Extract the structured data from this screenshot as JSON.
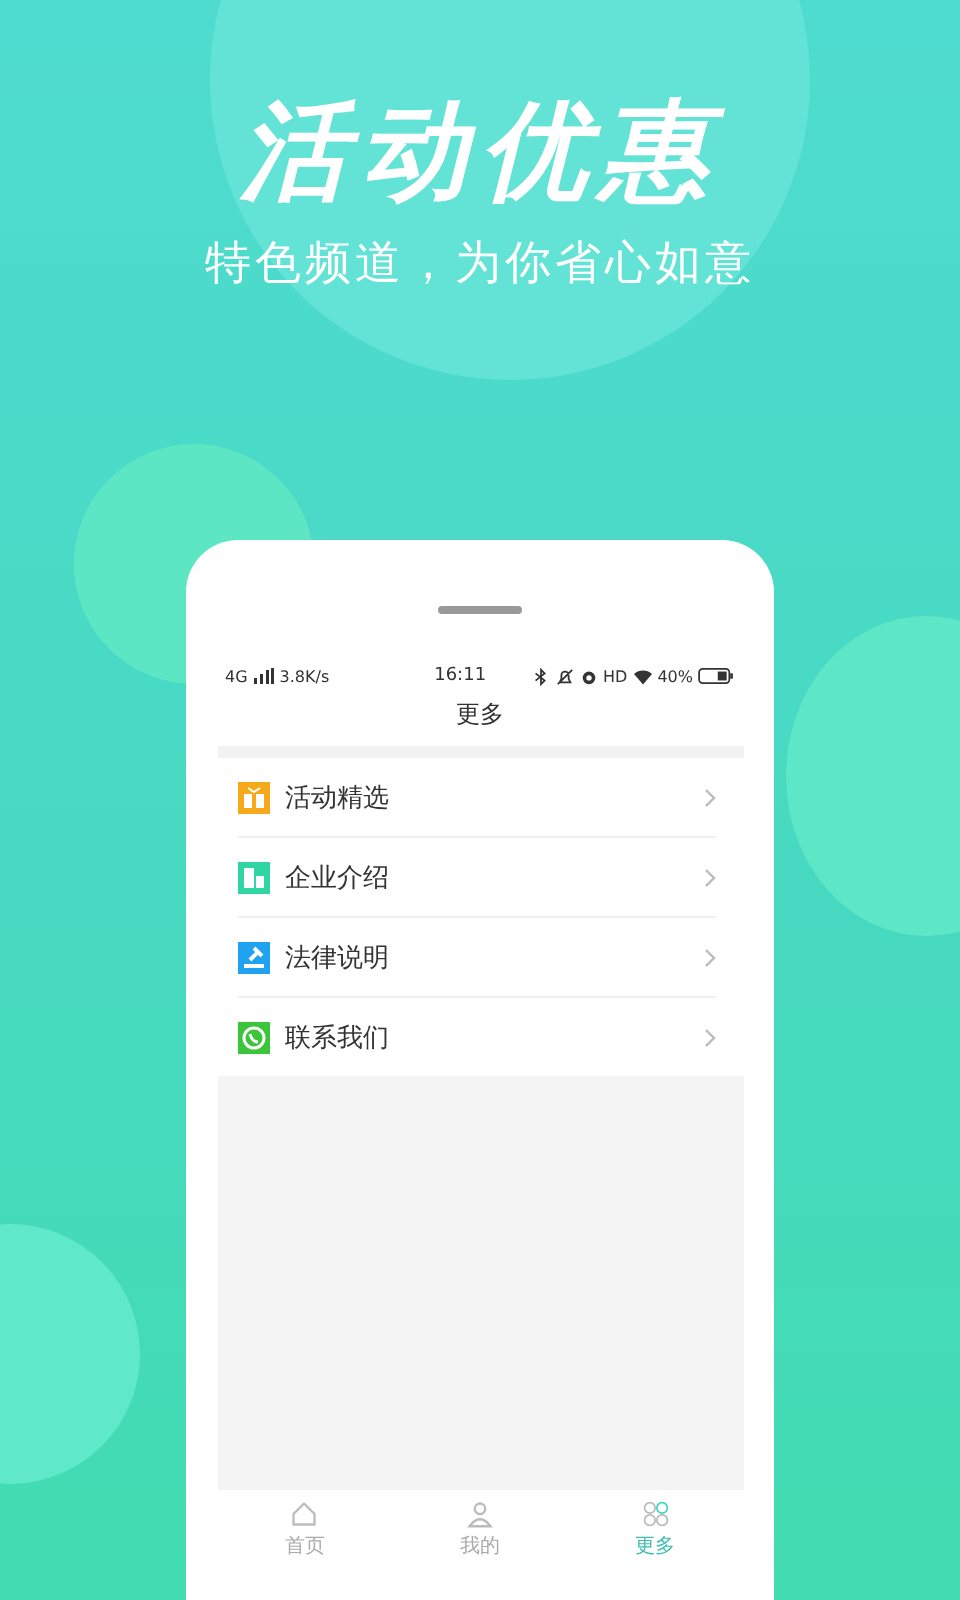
{
  "headline": "活动优惠",
  "subtitle": "特色频道，为你省心如意",
  "status_bar": {
    "network": "4G",
    "speed": "3.8K/s",
    "time": "16:11",
    "hd": "HD",
    "battery": "40%"
  },
  "page_title": "更多",
  "menu": [
    {
      "label": "活动精选",
      "kind": "gift",
      "color": "#f5a91b"
    },
    {
      "label": "企业介绍",
      "kind": "building",
      "color": "#2fd6a3"
    },
    {
      "label": "法律说明",
      "kind": "gavel",
      "color": "#1fa3f0"
    },
    {
      "label": "联系我们",
      "kind": "phone",
      "color": "#3cc43a"
    }
  ],
  "tabs": [
    {
      "label": "首页",
      "kind": "home",
      "selected": false
    },
    {
      "label": "我的",
      "kind": "person",
      "selected": false
    },
    {
      "label": "更多",
      "kind": "grid",
      "selected": true
    }
  ]
}
